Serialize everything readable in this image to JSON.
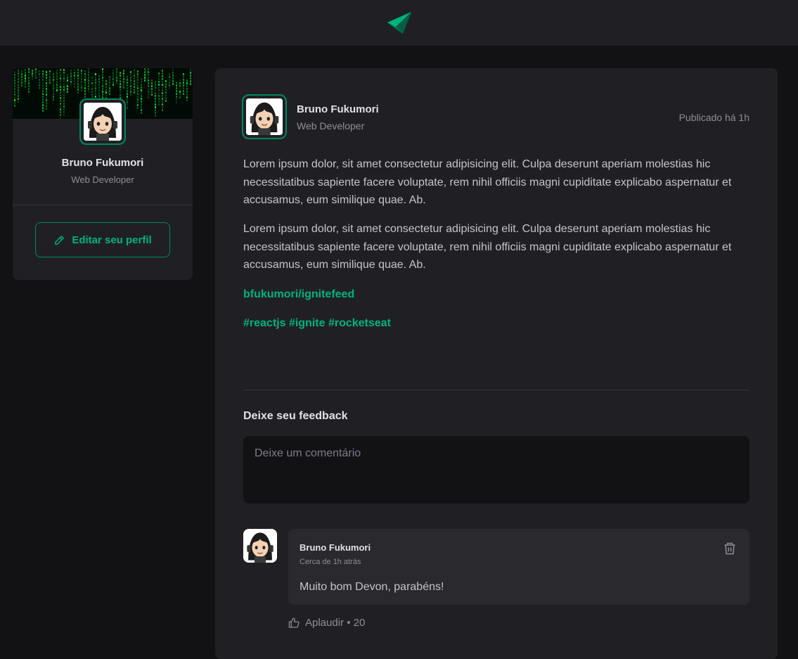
{
  "header": {
    "logo_icon": "ignite-logo-icon"
  },
  "colors": {
    "accent": "#00b37e",
    "accent_border": "#00875f",
    "background": "#121214",
    "card": "#202024"
  },
  "sidebar": {
    "name": "Bruno Fukumori",
    "role": "Web Developer",
    "edit_button_label": "Editar seu perfil",
    "edit_icon": "pencil-icon"
  },
  "post": {
    "author_name": "Bruno Fukumori",
    "author_role": "Web Developer",
    "published": "Publicado há 1h",
    "paragraphs": [
      "Lorem ipsum dolor, sit amet consectetur adipisicing elit. Culpa deserunt aperiam molestias hic necessitatibus sapiente facere voluptate, rem nihil officiis magni cupiditate explicabo aspernatur et accusamus, eum similique quae. Ab.",
      "Lorem ipsum dolor, sit amet consectetur adipisicing elit. Culpa deserunt aperiam molestias hic necessitatibus sapiente facere voluptate, rem nihil officiis magni cupiditate explicabo aspernatur et accusamus, eum similique quae. Ab."
    ],
    "link": "bfukumori/ignitefeed",
    "hashtags": "#reactjs #ignite #rocketseat"
  },
  "feedback": {
    "title": "Deixe seu feedback",
    "placeholder": "Deixe um comentário"
  },
  "comment": {
    "author_name": "Bruno Fukumori",
    "time": "Cerca de 1h atrás",
    "text": "Muito bom Devon, parabéns!",
    "delete_icon": "trash-icon",
    "applaud_icon": "thumbs-up-icon",
    "applaud_label": "Aplaudir",
    "applaud_separator": " • ",
    "applaud_count": "20"
  }
}
